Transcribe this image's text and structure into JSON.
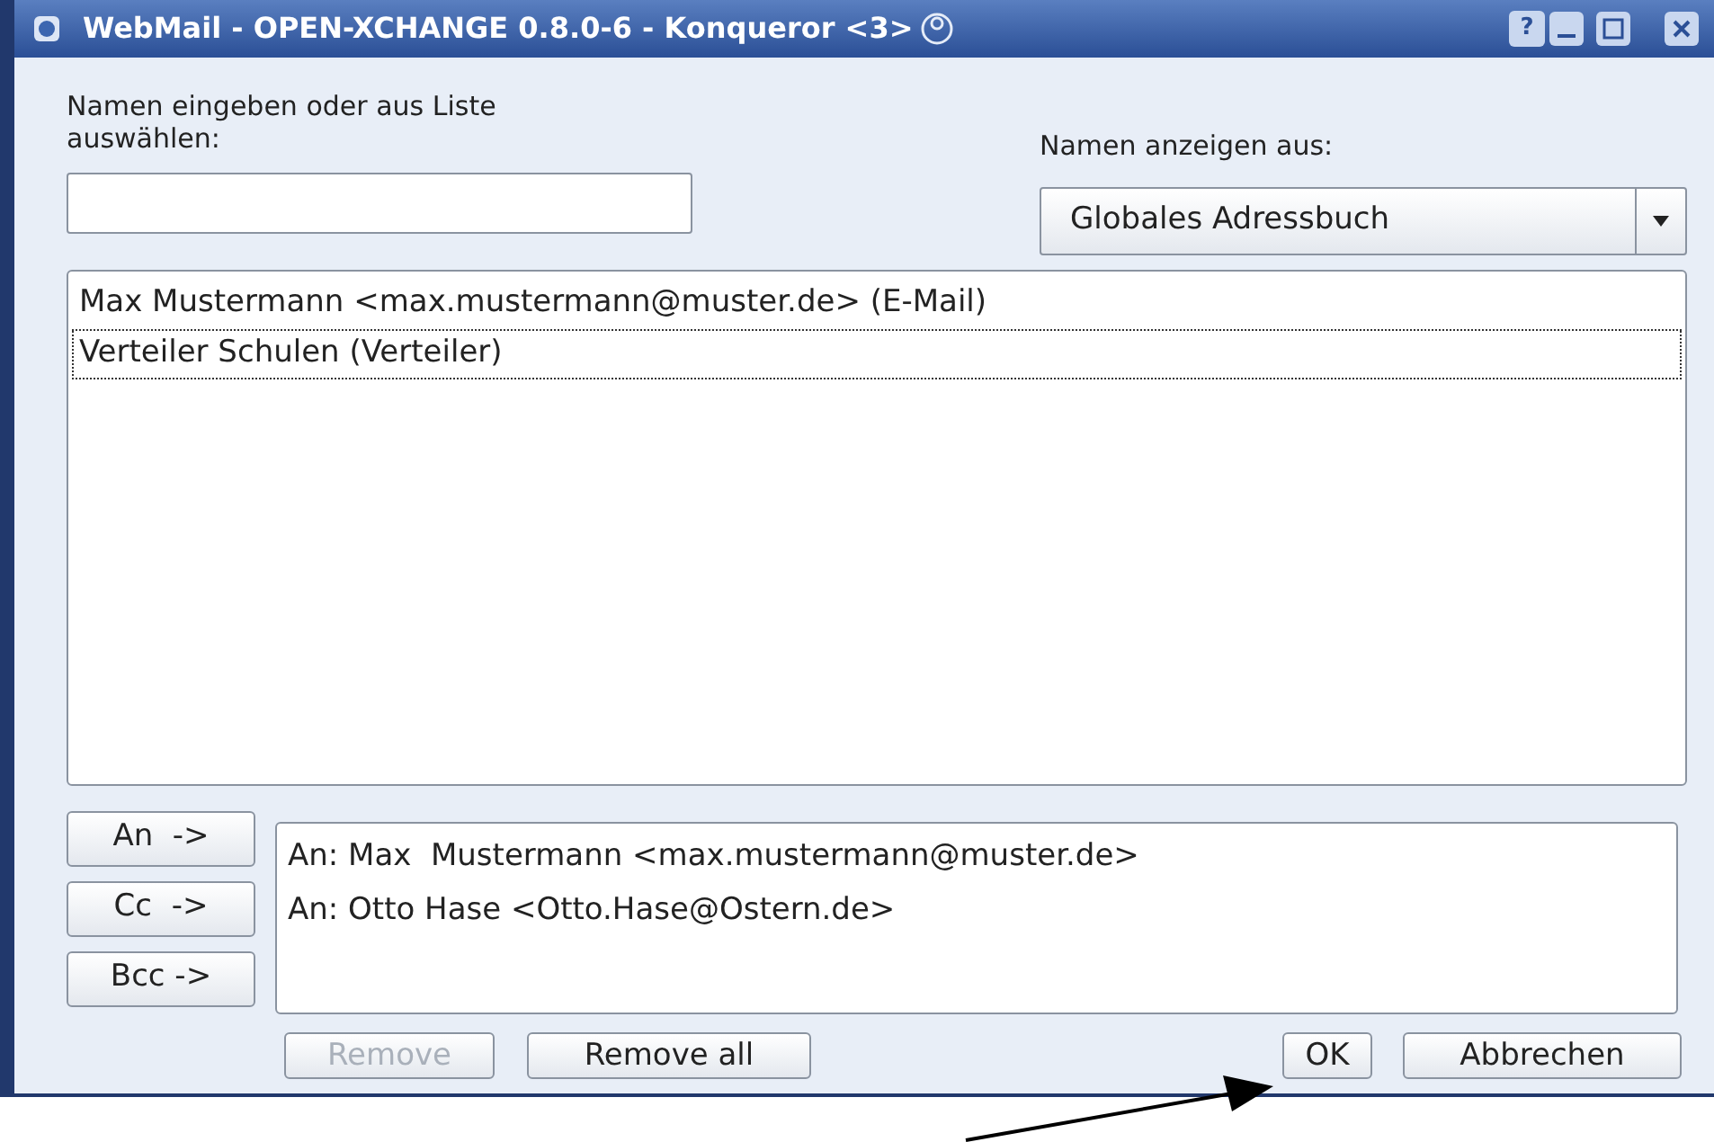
{
  "window": {
    "title": "WebMail - OPEN-XCHANGE 0.8.0-6 - Konqueror <3>",
    "title_buttons": [
      "?"
    ]
  },
  "name_field": {
    "label": "Namen eingeben oder aus Liste auswählen:"
  },
  "source": {
    "label": "Namen anzeigen aus:",
    "value": "Globales Adressbuch"
  },
  "names": [
    {
      "text": "Max Mustermann <max.mustermann@muster.de> (E-Mail)",
      "selected": false
    },
    {
      "text": "Verteiler Schulen (Verteiler)",
      "selected": true
    }
  ],
  "add_buttons": [
    "An  ->",
    "Cc  ->",
    "Bcc ->"
  ],
  "recipients": [
    "An: Max  Mustermann <max.mustermann@muster.de>",
    "An: Otto Hase <Otto.Hase@Ostern.de>"
  ],
  "buttons": [
    {
      "label": "Remove",
      "disabled": true
    },
    {
      "label": "Remove all",
      "disabled": false
    },
    {
      "label": "OK",
      "disabled": false
    },
    {
      "label": "Abbrechen",
      "disabled": false
    }
  ]
}
